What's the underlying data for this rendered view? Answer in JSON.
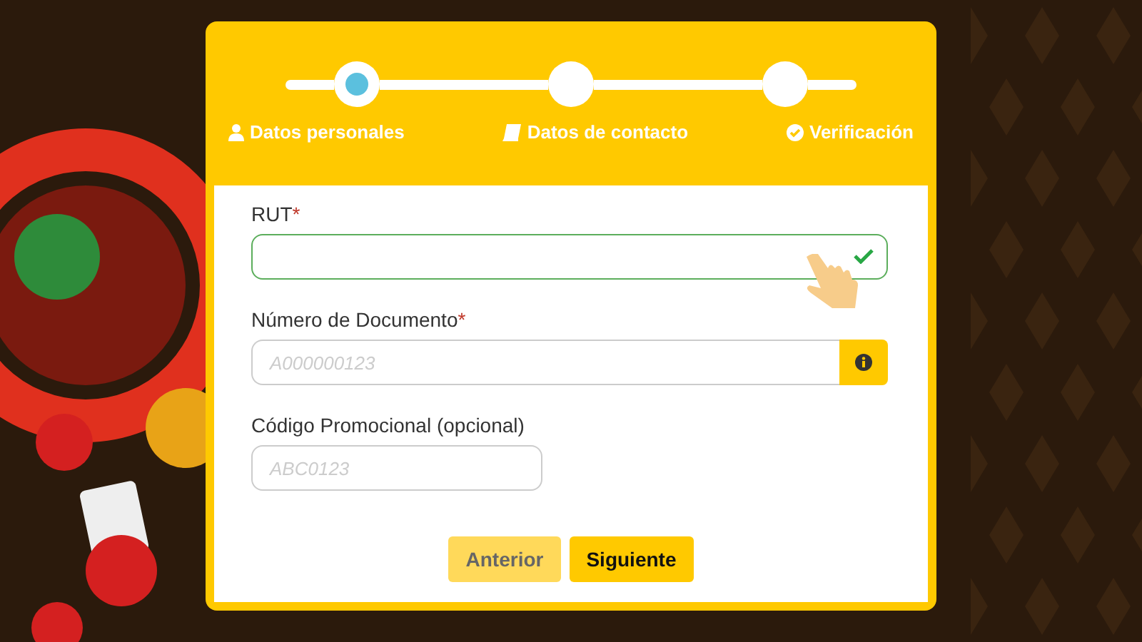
{
  "steps": [
    {
      "label": "Datos personales",
      "selected": true
    },
    {
      "label": "Datos de contacto",
      "selected": false
    },
    {
      "label": "Verificación",
      "selected": false
    }
  ],
  "fields": [
    {
      "label": "RUT",
      "required_mark": "*",
      "kind": "valid"
    },
    {
      "label": "Número de Documento",
      "required_mark": "*",
      "kind": "info",
      "placeholder": "A000000123"
    },
    {
      "label": "Código Promocional (opcional)",
      "kind": "plain",
      "placeholder": "ABC0123"
    }
  ],
  "buttons": [
    {
      "label": "Anterior",
      "disabled": true
    },
    {
      "label": "Siguiente",
      "disabled": false
    }
  ]
}
